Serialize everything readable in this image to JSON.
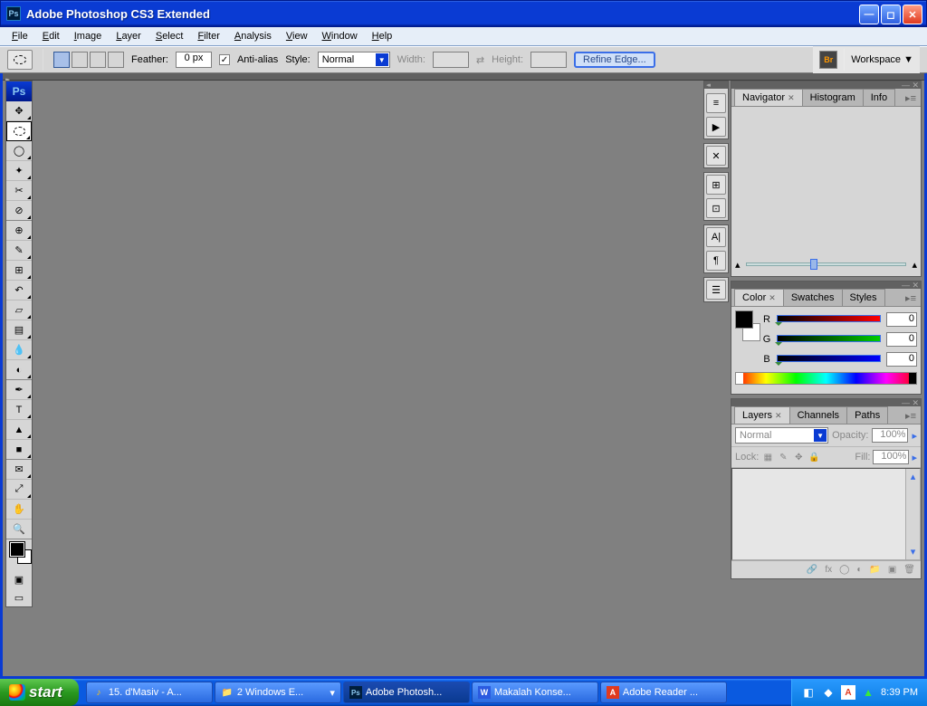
{
  "window": {
    "title": "Adobe Photoshop CS3 Extended",
    "icon": "Ps"
  },
  "menubar": [
    "File",
    "Edit",
    "Image",
    "Layer",
    "Select",
    "Filter",
    "Analysis",
    "View",
    "Window",
    "Help"
  ],
  "options": {
    "feather_label": "Feather:",
    "feather_value": "0 px",
    "antialias_label": "Anti-alias",
    "antialias_checked": "✓",
    "style_label": "Style:",
    "style_value": "Normal",
    "width_label": "Width:",
    "width_value": "",
    "height_label": "Height:",
    "height_value": "",
    "refine_label": "Refine Edge...",
    "workspace_label": "Workspace ▼",
    "br_label": "Br"
  },
  "panels": {
    "navigator": {
      "tabs": [
        "Navigator",
        "Histogram",
        "Info"
      ],
      "active": 0
    },
    "color": {
      "tabs": [
        "Color",
        "Swatches",
        "Styles"
      ],
      "active": 0,
      "channels": {
        "r_label": "R",
        "r_value": "0",
        "g_label": "G",
        "g_value": "0",
        "b_label": "B",
        "b_value": "0"
      }
    },
    "layers": {
      "tabs": [
        "Layers",
        "Channels",
        "Paths"
      ],
      "active": 0,
      "blendmode": "Normal",
      "opacity_label": "Opacity:",
      "opacity_value": "100%",
      "lock_label": "Lock:",
      "fill_label": "Fill:",
      "fill_value": "100%"
    }
  },
  "taskbar": {
    "start": "start",
    "items": [
      {
        "label": "15. d'Masiv - A...",
        "icon": "♪"
      },
      {
        "label": "2 Windows E...",
        "icon": "📁"
      },
      {
        "label": "Adobe Photosh...",
        "icon": "Ps",
        "active": true
      },
      {
        "label": "Makalah Konse...",
        "icon": "W"
      },
      {
        "label": "Adobe Reader ...",
        "icon": "A"
      }
    ],
    "time": "8:39 PM"
  }
}
